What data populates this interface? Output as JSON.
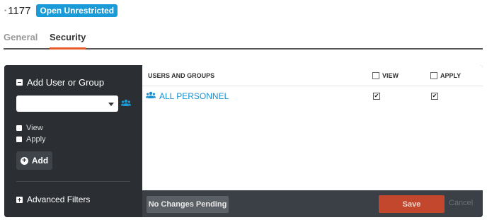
{
  "header": {
    "indicator": "•",
    "id_number": "1177",
    "badge": "Open Unrestricted"
  },
  "tabs": [
    {
      "label": "General",
      "active": false
    },
    {
      "label": "Security",
      "active": true
    }
  ],
  "sidebar": {
    "add_section_title": "Add User or Group",
    "select": {
      "value": ""
    },
    "options": [
      {
        "label": "View",
        "checked": false
      },
      {
        "label": "Apply",
        "checked": false
      }
    ],
    "add_button": "Add",
    "advanced_filters": "Advanced Filters"
  },
  "table": {
    "headers": {
      "users_groups": "USERS AND GROUPS",
      "view": "VIEW",
      "apply": "APPLY"
    },
    "rows": [
      {
        "name": "ALL PERSONNEL",
        "view": true,
        "apply": true,
        "check_glyph": "✔"
      }
    ]
  },
  "footer": {
    "pending": "No Changes Pending",
    "save": "Save",
    "cancel": "Cancel"
  },
  "colors": {
    "accent_blue": "#1a9ad6",
    "tab_underline": "#e85a2a",
    "save": "#c2472d",
    "panel_dark": "#2b2f33"
  },
  "icons": {
    "users_group": "users-icon",
    "minus_box": "minus-square-icon",
    "plus_box": "plus-square-icon",
    "plus_circle": "plus-circle-icon"
  }
}
